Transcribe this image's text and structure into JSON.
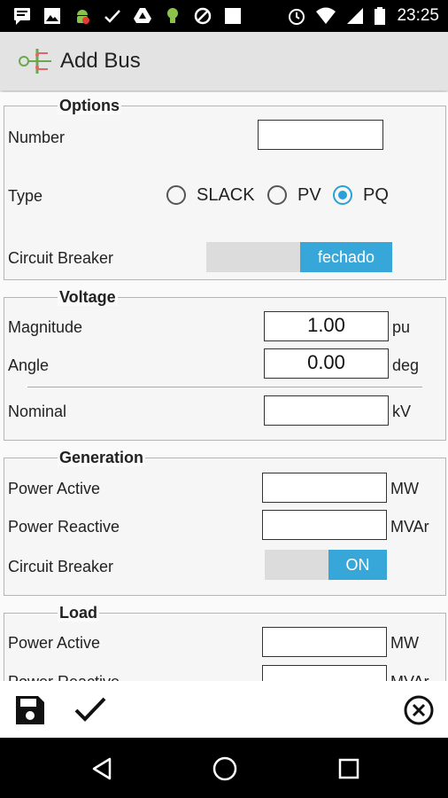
{
  "status_bar": {
    "time": "23:25",
    "left_icons": [
      "message-icon",
      "image-icon",
      "android-debug-icon",
      "check-icon",
      "drive-icon",
      "lightbulb-icon",
      "blocked-icon",
      "square-icon"
    ],
    "right_icons": [
      "alarm-icon",
      "wifi-icon",
      "signal-icon",
      "battery-icon"
    ]
  },
  "app_bar": {
    "title": "Add Bus",
    "icon": "bus-app-icon"
  },
  "options": {
    "title": "Options",
    "number_label": "Number",
    "number_value": "",
    "type_label": "Type",
    "type_options": [
      "SLACK",
      "PV",
      "PQ"
    ],
    "type_selected": "PQ",
    "circuit_breaker_label": "Circuit Breaker",
    "circuit_breaker_state": "fechado"
  },
  "voltage": {
    "title": "Voltage",
    "magnitude_label": "Magnitude",
    "magnitude_value": "1.00",
    "magnitude_unit": "pu",
    "angle_label": "Angle",
    "angle_value": "0.00",
    "angle_unit": "deg",
    "nominal_label": "Nominal",
    "nominal_value": "",
    "nominal_unit": "kV"
  },
  "generation": {
    "title": "Generation",
    "power_active_label": "Power Active",
    "power_active_value": "",
    "power_active_unit": "MW",
    "power_reactive_label": "Power Reactive",
    "power_reactive_value": "",
    "power_reactive_unit": "MVAr",
    "circuit_breaker_label": "Circuit Breaker",
    "circuit_breaker_state": "ON"
  },
  "load": {
    "title": "Load",
    "power_active_label": "Power Active",
    "power_active_value": "",
    "power_active_unit": "MW",
    "power_reactive_label": "Power Reactive",
    "power_reactive_value": "",
    "power_reactive_unit": "MVAr"
  },
  "bottom_actions": [
    "save-icon",
    "check-icon",
    "close-circle-icon"
  ],
  "nav_bar": [
    "back-icon",
    "home-icon",
    "recents-icon"
  ],
  "colors": {
    "accent": "#36a7d8",
    "status_bar": "#000000",
    "app_bar": "#e3e3e3"
  }
}
